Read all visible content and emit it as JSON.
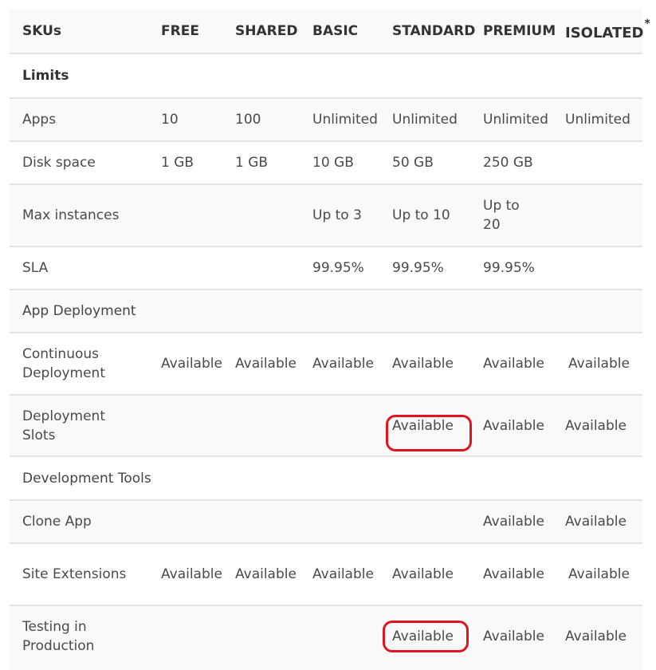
{
  "table": {
    "columns": [
      "SKUs",
      "FREE",
      "SHARED",
      "BASIC",
      "STANDARD",
      "PREMIUM",
      "ISOLATED"
    ],
    "isolated_footnote_marker": "*",
    "rows": [
      {
        "type": "section",
        "label": "Limits",
        "bold": true
      },
      {
        "type": "data",
        "label": "Apps",
        "values": [
          "10",
          "100",
          "Unlimited",
          "Unlimited",
          "Unlimited",
          "Unlimited"
        ]
      },
      {
        "type": "data",
        "label": "Disk space",
        "values": [
          "1 GB",
          "1 GB",
          "10 GB",
          "50 GB",
          "250 GB",
          ""
        ]
      },
      {
        "type": "data",
        "label": "Max instances",
        "values": [
          "",
          "",
          "Up to 3",
          "Up to 10",
          "Up to 20",
          ""
        ]
      },
      {
        "type": "data",
        "label": "SLA",
        "values": [
          "",
          "",
          "99.95%",
          "99.95%",
          "99.95%",
          ""
        ]
      },
      {
        "type": "section",
        "label": "App Deployment",
        "bold": false
      },
      {
        "type": "data",
        "label": "Continuous Deployment",
        "values": [
          "Available",
          "Available",
          "Available",
          "Available",
          "Available",
          "Available"
        ]
      },
      {
        "type": "data",
        "label": "Deployment Slots",
        "values": [
          "",
          "",
          "",
          "Available",
          "Available",
          "Available"
        ],
        "highlighted_column": "STANDARD"
      },
      {
        "type": "section",
        "label": "Development Tools",
        "bold": false
      },
      {
        "type": "data",
        "label": "Clone App",
        "values": [
          "",
          "",
          "",
          "",
          "Available",
          "Available"
        ]
      },
      {
        "type": "data",
        "label": "Site Extensions",
        "values": [
          "Available",
          "Available",
          "Available",
          "Available",
          "Available",
          "Available"
        ]
      },
      {
        "type": "data",
        "label": "Testing in Production",
        "values": [
          "",
          "",
          "",
          "Available",
          "Available",
          "Available"
        ],
        "highlighted_column": "STANDARD"
      }
    ]
  },
  "colors": {
    "highlight": "#e0141e",
    "row_alt_bg": "#f9f9f9",
    "border": "#e4e4e4"
  }
}
